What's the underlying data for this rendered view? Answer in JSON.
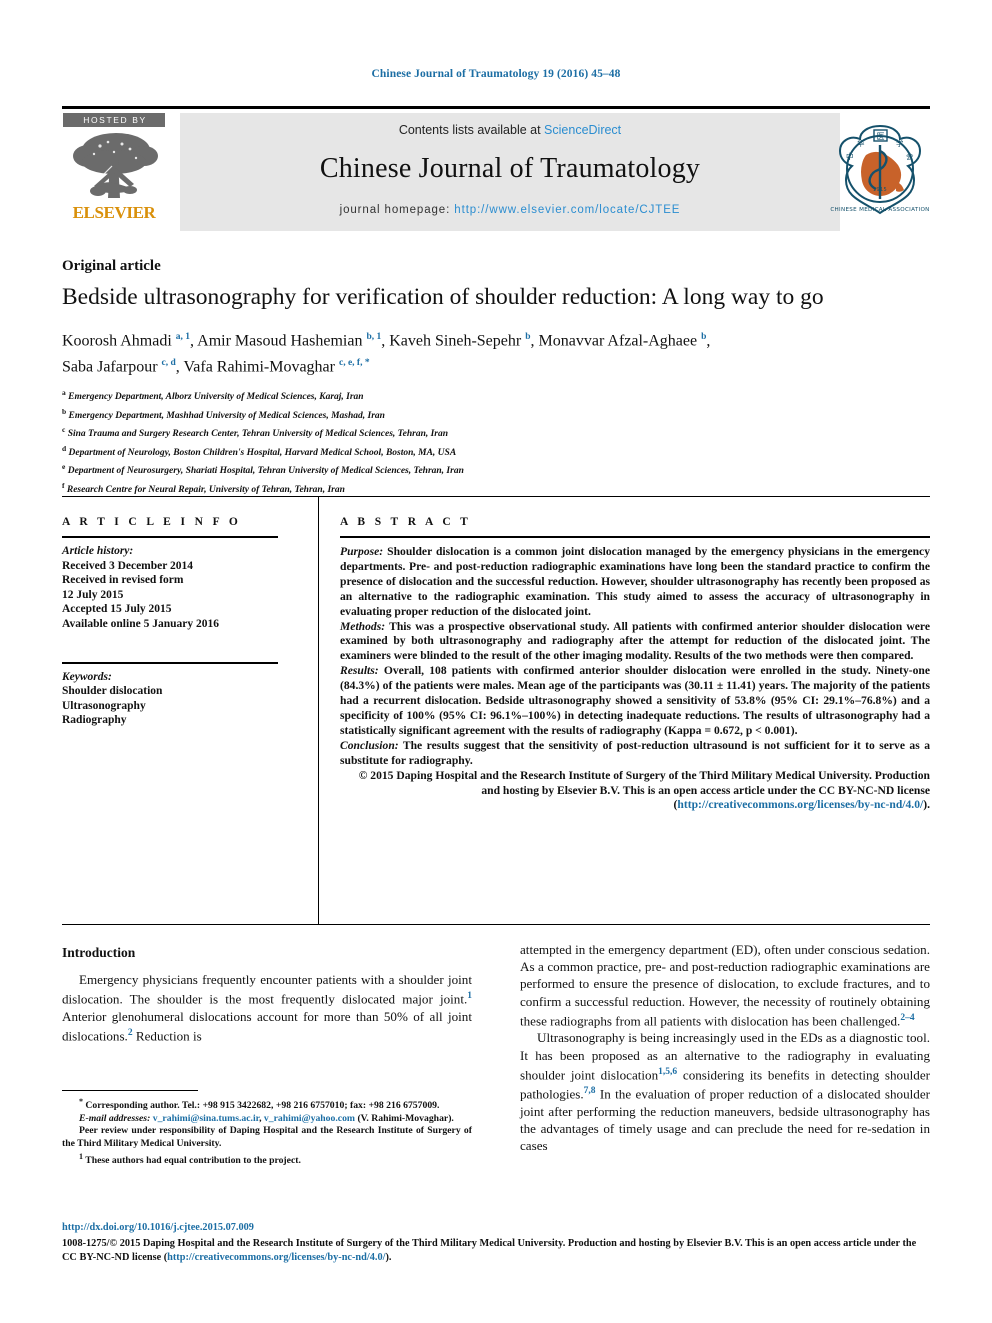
{
  "running_head": "Chinese Journal of Traumatology 19 (2016) 45–48",
  "masthead": {
    "hosted_by": "HOSTED BY",
    "publisher": "ELSEVIER",
    "contents_prefix": "Contents lists available at ",
    "contents_link": "ScienceDirect",
    "journal_name": "Chinese Journal of Traumatology",
    "homepage_prefix": "journal homepage: ",
    "homepage_url": "http://www.elsevier.com/locate/CJTEE",
    "cma_caption": "CHINESE MEDICAL ASSOCIATION",
    "cma_year": "1915"
  },
  "article": {
    "type": "Original article",
    "title": "Bedside ultrasonography for verification of shoulder reduction: A long way to go",
    "authors_line1": "Koorosh Ahmadi ",
    "authors_sup1": "a, 1",
    "authors_line1b": ", Amir Masoud Hashemian ",
    "authors_sup2": "b, 1",
    "authors_line1c": ", Kaveh Sineh-Sepehr ",
    "authors_sup3": "b",
    "authors_line1d": ", Monavvar Afzal-Aghaee ",
    "authors_sup4": "b",
    "authors_line1e": ",",
    "authors_line2": "Saba Jafarpour ",
    "authors_sup5": "c, d",
    "authors_line2b": ", Vafa Rahimi-Movaghar ",
    "authors_sup6": "c, e, f, *",
    "affiliations": [
      {
        "mark": "a",
        "text": "Emergency Department, Alborz University of Medical Sciences, Karaj, Iran"
      },
      {
        "mark": "b",
        "text": "Emergency Department, Mashhad University of Medical Sciences, Mashad, Iran"
      },
      {
        "mark": "c",
        "text": "Sina Trauma and Surgery Research Center, Tehran University of Medical Sciences, Tehran, Iran"
      },
      {
        "mark": "d",
        "text": "Department of Neurology, Boston Children's Hospital, Harvard Medical School, Boston, MA, USA"
      },
      {
        "mark": "e",
        "text": "Department of Neurosurgery, Shariati Hospital, Tehran University of Medical Sciences, Tehran, Iran"
      },
      {
        "mark": "f",
        "text": "Research Centre for Neural Repair, University of Tehran, Tehran, Iran"
      }
    ]
  },
  "article_info": {
    "heading": "A R T I C L E    I N F O",
    "history_label": "Article history:",
    "history": [
      "Received 3 December 2014",
      "Received in revised form",
      "12 July 2015",
      "Accepted 15 July 2015",
      "Available online 5 January 2016"
    ],
    "keywords_label": "Keywords:",
    "keywords": [
      "Shoulder dislocation",
      "Ultrasonography",
      "Radiography"
    ]
  },
  "abstract": {
    "heading": "A B S T R A C T",
    "purpose_label": "Purpose:",
    "purpose_text": " Shoulder dislocation is a common joint dislocation managed by the emergency physicians in the emergency departments. Pre- and post-reduction radiographic examinations have long been the standard practice to confirm the presence of dislocation and the successful reduction. However, shoulder ultrasonography has recently been proposed as an alternative to the radiographic examination. This study aimed to assess the accuracy of ultrasonography in evaluating proper reduction of the dislocated joint.",
    "methods_label": "Methods:",
    "methods_text": " This was a prospective observational study. All patients with confirmed anterior shoulder dislocation were examined by both ultrasonography and radiography after the attempt for reduction of the dislocated joint. The examiners were blinded to the result of the other imaging modality. Results of the two methods were then compared.",
    "results_label": "Results:",
    "results_text": " Overall, 108 patients with confirmed anterior shoulder dislocation were enrolled in the study. Ninety-one (84.3%) of the patients were males. Mean age of the participants was (30.11 ± 11.41) years. The majority of the patients had a recurrent dislocation. Bedside ultrasonography showed a sensitivity of 53.8% (95% CI: 29.1%–76.8%) and a specificity of 100% (95% CI: 96.1%–100%) in detecting inadequate reductions. The results of ultrasonography had a statistically significant agreement with the results of radiography (Kappa = 0.672, p < 0.001).",
    "conclusion_label": "Conclusion:",
    "conclusion_text": " The results suggest that the sensitivity of post-reduction ultrasound is not sufficient for it to serve as a substitute for radiography.",
    "copyright_text": "© 2015 Daping Hospital and the Research Institute of Surgery of the Third Military Medical University. Production and hosting by Elsevier B.V. This is an open access article under the CC BY-NC-ND license (",
    "copyright_link": "http://creativecommons.org/licenses/by-nc-nd/4.0/",
    "copyright_tail": ")."
  },
  "body": {
    "intro_heading": "Introduction",
    "left_p1_a": "Emergency physicians frequently encounter patients with a shoulder joint dislocation. The shoulder is the most frequently dislocated major joint.",
    "left_p1_ref1": "1",
    "left_p1_b": " Anterior glenohumeral dislocations account for more than 50% of all joint dislocations.",
    "left_p1_ref2": "2",
    "left_p1_c": " Reduction is",
    "right_p1_a": "attempted in the emergency department (ED), often under conscious sedation. As a common practice, pre- and post-reduction radiographic examinations are performed to ensure the presence of dislocation, to exclude fractures, and to confirm a successful reduction. However, the necessity of routinely obtaining these radiographs from all patients with dislocation has been challenged.",
    "right_p1_ref": "2–4",
    "right_p2_a": "Ultrasonography is being increasingly used in the EDs as a diagnostic tool. It has been proposed as an alternative to the radiography in evaluating shoulder joint dislocation",
    "right_p2_ref1": "1,5,6",
    "right_p2_b": " considering its benefits in detecting shoulder pathologies.",
    "right_p2_ref2": "7,8",
    "right_p2_c": " In the evaluation of proper reduction of a dislocated shoulder joint after performing the reduction maneuvers, bedside ultrasonography has the advantages of timely usage and can preclude the need for re-sedation in cases"
  },
  "footnotes": {
    "corresponding_mark": "*",
    "corresponding": " Corresponding author. Tel.: +98 915 3422682, +98 216 6757010; fax: +98 216 6757009.",
    "email_label": "E-mail addresses:",
    "email1": "v_rahimi@sina.tums.ac.ir",
    "email_sep": ", ",
    "email2": "v_rahimi@yahoo.com",
    "email_tail": " (V. Rahimi-Movaghar).",
    "peer_review": "Peer review under responsibility of Daping Hospital and the Research Institute of Surgery of the Third Military Medical University.",
    "equal_mark": "1",
    "equal_contribution": " These authors had equal contribution to the project."
  },
  "bottom": {
    "doi": "http://dx.doi.org/10.1016/j.cjtee.2015.07.009",
    "copy_a": "1008-1275/© 2015 Daping Hospital and the Research Institute of Surgery of the Third Military Medical University. Production and hosting by Elsevier B.V. This is an open access article under the CC BY-NC-ND license (",
    "copy_link": "http://creativecommons.org/licenses/by-nc-nd/4.0/",
    "copy_b": ")."
  },
  "colors": {
    "link": "#1c6ea4",
    "link_light": "#2b8dd0",
    "elsevier_orange": "#d9900a",
    "band": "#e6e6e6",
    "hosted_gray": "#6b6b6b",
    "cma_teal": "#15516b",
    "cma_orange": "#c8622a"
  }
}
